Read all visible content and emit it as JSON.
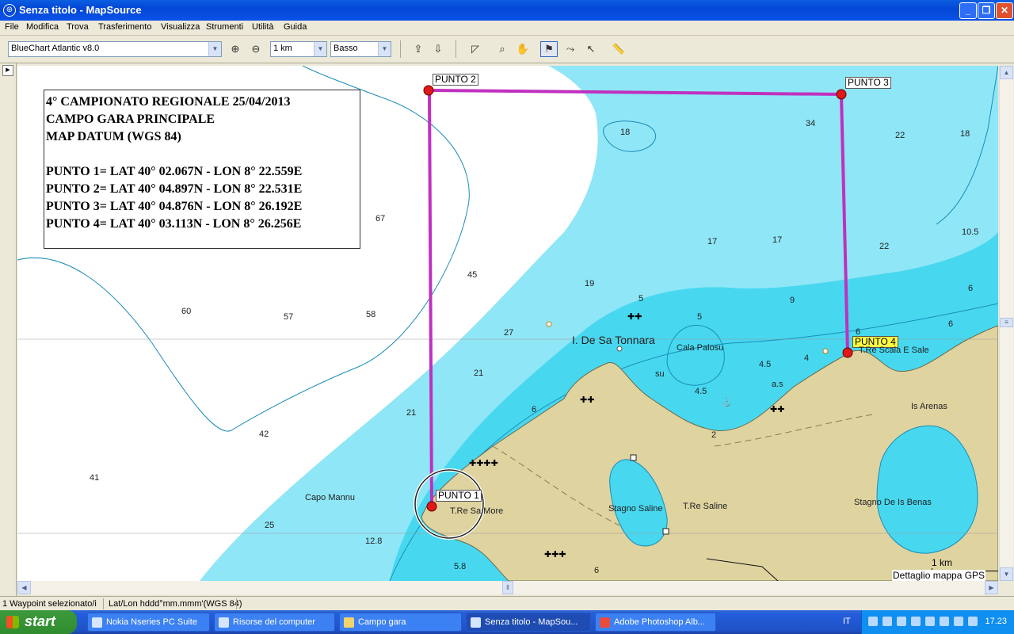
{
  "window": {
    "title": "Senza titolo - MapSource"
  },
  "menu": [
    "File",
    "Modifica",
    "Trova",
    "Trasferimento",
    "Visualizza",
    "Strumenti",
    "Utilità",
    "Guida"
  ],
  "toolbar": {
    "map_product": "BlueChart Atlantic v8.0",
    "zoom_scale": "1 km",
    "detail_level": "Basso"
  },
  "info_box": {
    "lines": [
      "4° CAMPIONATO REGIONALE  25/04/2013",
      "CAMPO GARA PRINCIPALE",
      "MAP DATUM (WGS 84)",
      "",
      "PUNTO 1= LAT 40° 02.067N - LON 8° 22.559E",
      "PUNTO 2= LAT 40° 04.897N - LON 8° 22.531E",
      "PUNTO 3= LAT 40° 04.876N - LON 8° 26.192E",
      "PUNTO 4= LAT 40° 03.113N - LON 8° 26.256E"
    ]
  },
  "waypoints": {
    "p1": "PUNTO 1",
    "p2": "PUNTO 2",
    "p3": "PUNTO 3",
    "p4": "PUNTO 4"
  },
  "places": {
    "island": "I. De Sa Tonnara",
    "cala": "Cala Palosu",
    "scala": "T.Re Scala E Sale",
    "arenas": "Is Arenas",
    "capo": "Capo Mannu",
    "more": "T.Re Sa More",
    "stagno_saline": "Stagno Saline",
    "tre_saline": "T.Re Saline",
    "benas": "Stagno De Is Benas",
    "su": "su",
    "as": "a.s"
  },
  "depths": [
    "18",
    "34",
    "22",
    "18",
    "67",
    "17",
    "17",
    "22",
    "10.5",
    "45",
    "19",
    "5",
    "5",
    "9",
    "6",
    "60",
    "57",
    "58",
    "27",
    "6",
    "6",
    "21",
    "4.5",
    "4",
    "21",
    "6",
    "4.5",
    "42",
    "2",
    "41",
    "25",
    "12.8",
    "5.8",
    "6"
  ],
  "scale_bar": {
    "label": "1 km",
    "detail": "Dettaglio mappa GPS"
  },
  "status": {
    "left": "1 Waypoint selezionato/i",
    "right": "Lat/Lon hddd°mm.mmm'(WGS 84)"
  },
  "taskbar": {
    "start": "start",
    "tasks": [
      "Nokia Nseries PC Suite",
      "Risorse del computer",
      "Campo gara",
      "Senza titolo - MapSou...",
      "Adobe Photoshop Alb..."
    ],
    "lang": "IT",
    "clock": "17.23"
  },
  "colors": {
    "land": "#dfd3a0",
    "shallow": "#47d8f0",
    "medium": "#8fe6f6",
    "deep": "#ffffff",
    "route": "#c030c0",
    "waypoint": "#e01818"
  }
}
